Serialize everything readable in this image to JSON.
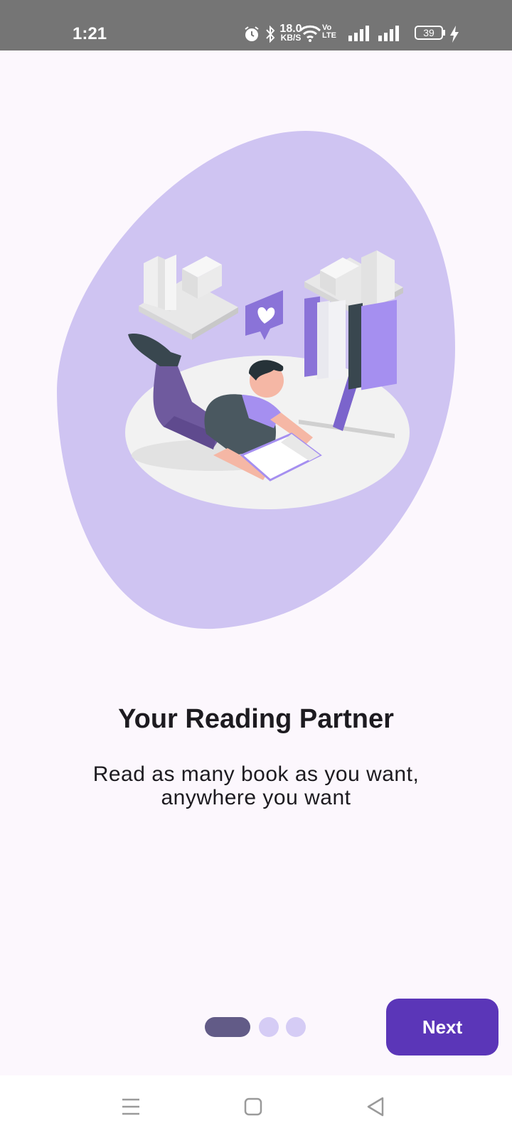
{
  "status_bar": {
    "time": "1:21",
    "net_speed_value": "18.0",
    "net_speed_unit": "KB/S",
    "network_label": "Vo LTE",
    "battery_level": "39",
    "icons": [
      "alarm-icon",
      "bluetooth-icon",
      "wifi-icon",
      "signal-icon",
      "signal-icon",
      "battery-icon",
      "charging-icon"
    ]
  },
  "onboarding": {
    "title": "Your Reading Partner",
    "subtitle": "Read as many book as you want, anywhere you want",
    "page_indicator": {
      "total": 3,
      "current": 1
    },
    "next_label": "Next"
  },
  "navigation_bar": {
    "icons": [
      "menu-icon",
      "home-icon",
      "back-icon"
    ]
  },
  "colors": {
    "background": "#fcf7fd",
    "blob": "#cfc4f2",
    "accent": "#5b36b8",
    "indicator_active": "#625b87",
    "indicator_inactive": "#d5ccf5",
    "status_bar": "#757575"
  }
}
